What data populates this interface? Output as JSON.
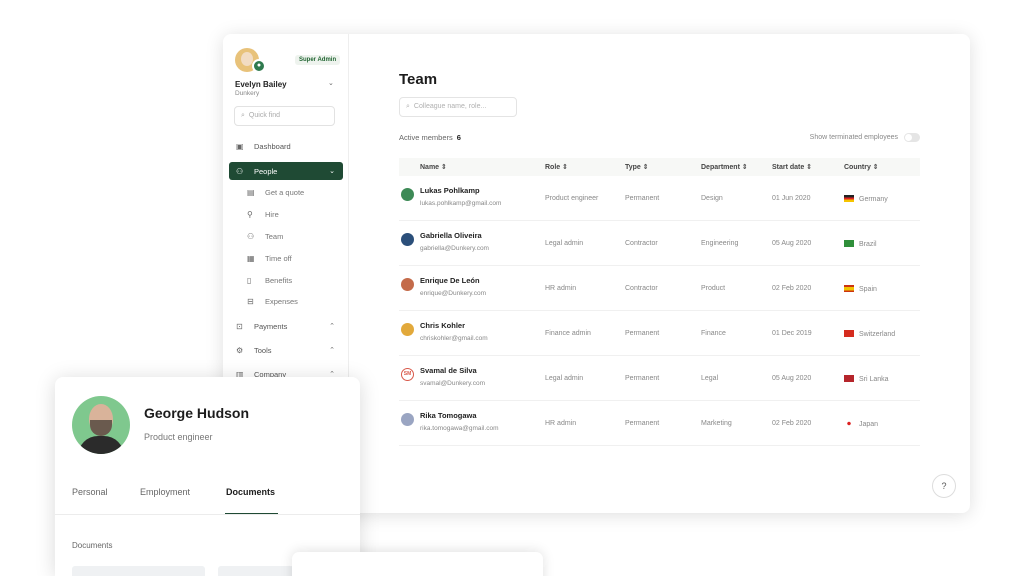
{
  "sidebar": {
    "user": {
      "name": "Evelyn Bailey",
      "org": "Dunkery",
      "badge": "Super Admin"
    },
    "quick_find_placeholder": "Quick find",
    "items": [
      {
        "label": "Dashboard",
        "icon": "dashboard-icon"
      },
      {
        "label": "People",
        "icon": "people-icon",
        "active": true
      },
      {
        "label": "Get a quote",
        "icon": "document-icon"
      },
      {
        "label": "Hire",
        "icon": "add-person-icon"
      },
      {
        "label": "Team",
        "icon": "team-icon"
      },
      {
        "label": "Time off",
        "icon": "calendar-icon"
      },
      {
        "label": "Benefits",
        "icon": "lock-icon"
      },
      {
        "label": "Expenses",
        "icon": "receipt-icon"
      },
      {
        "label": "Payments",
        "icon": "payments-icon"
      },
      {
        "label": "Tools",
        "icon": "tools-icon"
      },
      {
        "label": "Company",
        "icon": "company-icon"
      }
    ]
  },
  "main": {
    "title": "Team",
    "search_placeholder": "Colleague name, role...",
    "active_members_label": "Active members",
    "active_members_count": "6",
    "show_terminated_label": "Show terminated employees",
    "columns": [
      "Name ⇕",
      "Role ⇕",
      "Type ⇕",
      "Department ⇕",
      "Start date ⇕",
      "Country ⇕"
    ],
    "rows": [
      {
        "name": "Lukas Pohlkamp",
        "email": "lukas.pohlkamp@gmail.com",
        "role": "Product engineer",
        "type": "Permanent",
        "department": "Design",
        "start": "01 Jun 2020",
        "country": "Germany",
        "avatar_color": "#3d8a56"
      },
      {
        "name": "Gabriella Oliveira",
        "email": "gabriella@Dunkery.com",
        "role": "Legal admin",
        "type": "Contractor",
        "department": "Engineering",
        "start": "05 Aug 2020",
        "country": "Brazil",
        "avatar_color": "#2b4f7a"
      },
      {
        "name": "Enrique De León",
        "email": "enrique@Dunkery.com",
        "role": "HR admin",
        "type": "Contractor",
        "department": "Product",
        "start": "02 Feb 2020",
        "country": "Spain",
        "avatar_color": "#c46b4a"
      },
      {
        "name": "Chris Kohler",
        "email": "chriskohler@gmail.com",
        "role": "Finance admin",
        "type": "Permanent",
        "department": "Finance",
        "start": "01 Dec 2019",
        "country": "Switzerland",
        "avatar_color": "#e2a93b"
      },
      {
        "name": "Svamal de Silva",
        "email": "svamal@Dunkery.com",
        "role": "Legal admin",
        "type": "Permanent",
        "department": "Legal",
        "start": "05 Aug 2020",
        "country": "Sri Lanka",
        "initials": "SM"
      },
      {
        "name": "Rika Tomogawa",
        "email": "rika.tomogawa@gmail.com",
        "role": "HR admin",
        "type": "Permanent",
        "department": "Marketing",
        "start": "02 Feb 2020",
        "country": "Japan",
        "avatar_color": "#9aa5c2"
      }
    ]
  },
  "profile_card": {
    "name": "George Hudson",
    "role": "Product engineer",
    "tabs": [
      "Personal",
      "Employment",
      "Documents"
    ],
    "active_tab": "Documents",
    "section_label": "Documents"
  },
  "colors": {
    "brand": "#1f4a34",
    "accent": "#2f7a4e"
  }
}
